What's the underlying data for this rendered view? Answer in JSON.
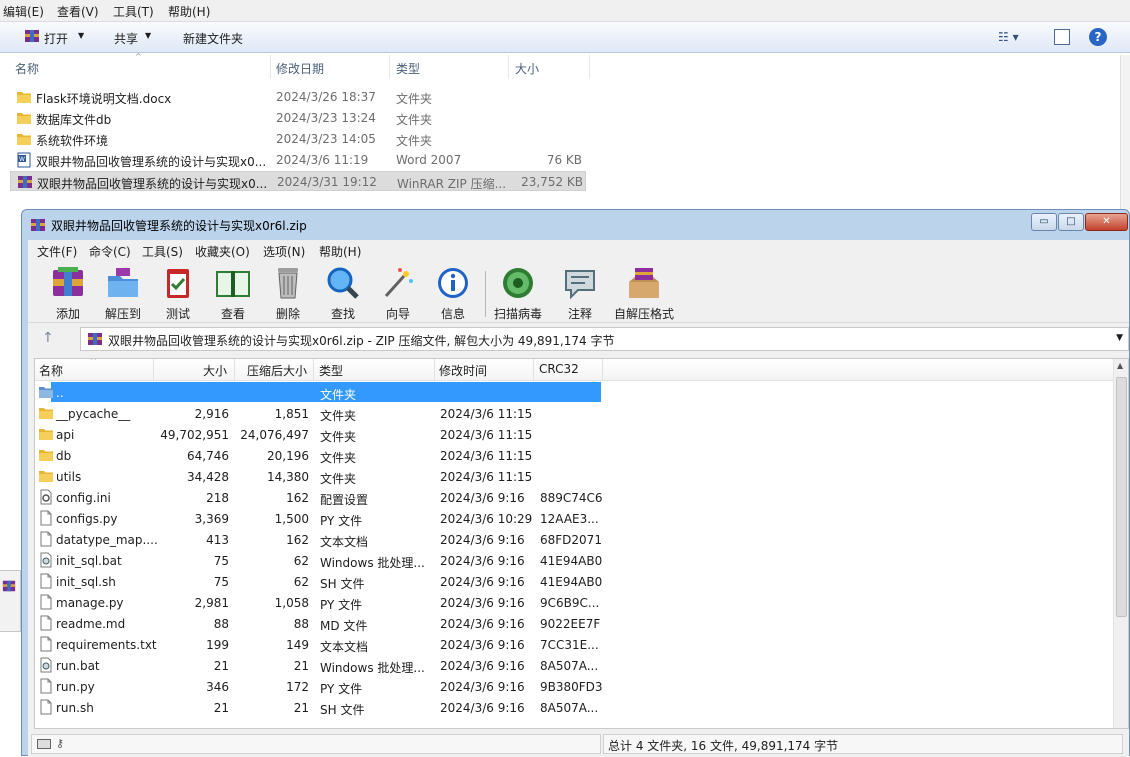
{
  "explorer": {
    "menu": [
      "编辑(E)",
      "查看(V)",
      "工具(T)",
      "帮助(H)"
    ],
    "toolbar": {
      "open": "打开",
      "share": "共享",
      "new_folder": "新建文件夹"
    },
    "columns": {
      "name": "名称",
      "date": "修改日期",
      "type": "类型",
      "size": "大小"
    },
    "files": [
      {
        "icon": "folder-icon",
        "name": "Flask环境说明文档.docx",
        "date": "2024/3/26 18:37",
        "type": "文件夹",
        "size": ""
      },
      {
        "icon": "folder-icon",
        "name": "数据库文件db",
        "date": "2024/3/23 13:24",
        "type": "文件夹",
        "size": ""
      },
      {
        "icon": "folder-icon",
        "name": "系统软件环境",
        "date": "2024/3/23 14:05",
        "type": "文件夹",
        "size": ""
      },
      {
        "icon": "word-doc-icon",
        "name": "双眼井物品回收管理系统的设计与实现x0...",
        "date": "2024/3/6 11:19",
        "type": "Word 2007",
        "size": "76 KB"
      },
      {
        "icon": "winrar-archive-icon",
        "name": "双眼井物品回收管理系统的设计与实现x0...",
        "date": "2024/3/31 19:12",
        "type": "WinRAR ZIP 压缩...",
        "size": "23,752 KB",
        "selected": true
      }
    ]
  },
  "rar": {
    "title": "双眼井物品回收管理系统的设计与实现x0r6l.zip",
    "window_buttons": {
      "minimize": "▭",
      "maximize": "□",
      "close": "✕"
    },
    "menu": [
      "文件(F)",
      "命令(C)",
      "工具(S)",
      "收藏夹(O)",
      "选项(N)",
      "帮助(H)"
    ],
    "tools": [
      {
        "icon": "add-archive-icon",
        "label": "添加"
      },
      {
        "icon": "extract-to-icon",
        "label": "解压到"
      },
      {
        "icon": "test-icon",
        "label": "测试"
      },
      {
        "icon": "view-icon",
        "label": "查看"
      },
      {
        "icon": "delete-icon",
        "label": "删除"
      },
      {
        "icon": "find-icon",
        "label": "查找"
      },
      {
        "icon": "wizard-icon",
        "label": "向导"
      },
      {
        "icon": "info-icon",
        "label": "信息"
      },
      {
        "icon": "virus-scan-icon",
        "label": "扫描病毒"
      },
      {
        "icon": "comment-icon",
        "label": "注释"
      },
      {
        "icon": "sfx-icon",
        "label": "自解压格式"
      }
    ],
    "address": "双眼井物品回收管理系统的设计与实现x0r6l.zip - ZIP 压缩文件, 解包大小为 49,891,174 字节",
    "columns": {
      "name": "名称",
      "size": "大小",
      "packed": "压缩后大小",
      "type": "类型",
      "modified": "修改时间",
      "crc": "CRC32"
    },
    "rows": [
      {
        "icon": "parent-folder-icon",
        "name": "..",
        "size": "",
        "packed": "",
        "type": "文件夹",
        "modified": "",
        "crc": "",
        "selected": true
      },
      {
        "icon": "folder-icon",
        "name": "__pycache__",
        "size": "2,916",
        "packed": "1,851",
        "type": "文件夹",
        "modified": "2024/3/6 11:15",
        "crc": ""
      },
      {
        "icon": "folder-icon",
        "name": "api",
        "size": "49,702,951",
        "packed": "24,076,497",
        "type": "文件夹",
        "modified": "2024/3/6 11:15",
        "crc": ""
      },
      {
        "icon": "folder-icon",
        "name": "db",
        "size": "64,746",
        "packed": "20,196",
        "type": "文件夹",
        "modified": "2024/3/6 11:15",
        "crc": ""
      },
      {
        "icon": "folder-icon",
        "name": "utils",
        "size": "34,428",
        "packed": "14,380",
        "type": "文件夹",
        "modified": "2024/3/6 11:15",
        "crc": ""
      },
      {
        "icon": "settings-file-icon",
        "name": "config.ini",
        "size": "218",
        "packed": "162",
        "type": "配置设置",
        "modified": "2024/3/6 9:16",
        "crc": "889C74C6"
      },
      {
        "icon": "file-icon",
        "name": "configs.py",
        "size": "3,369",
        "packed": "1,500",
        "type": "PY 文件",
        "modified": "2024/3/6 10:29",
        "crc": "12AAE3..."
      },
      {
        "icon": "file-icon",
        "name": "datatype_map....",
        "size": "413",
        "packed": "162",
        "type": "文本文档",
        "modified": "2024/3/6 9:16",
        "crc": "68FD2071"
      },
      {
        "icon": "batch-file-icon",
        "name": "init_sql.bat",
        "size": "75",
        "packed": "62",
        "type": "Windows 批处理...",
        "modified": "2024/3/6 9:16",
        "crc": "41E94AB0"
      },
      {
        "icon": "file-icon",
        "name": "init_sql.sh",
        "size": "75",
        "packed": "62",
        "type": "SH 文件",
        "modified": "2024/3/6 9:16",
        "crc": "41E94AB0"
      },
      {
        "icon": "file-icon",
        "name": "manage.py",
        "size": "2,981",
        "packed": "1,058",
        "type": "PY 文件",
        "modified": "2024/3/6 9:16",
        "crc": "9C6B9C..."
      },
      {
        "icon": "file-icon",
        "name": "readme.md",
        "size": "88",
        "packed": "88",
        "type": "MD 文件",
        "modified": "2024/3/6 9:16",
        "crc": "9022EE7F"
      },
      {
        "icon": "file-icon",
        "name": "requirements.txt",
        "size": "199",
        "packed": "149",
        "type": "文本文档",
        "modified": "2024/3/6 9:16",
        "crc": "7CC31E..."
      },
      {
        "icon": "batch-file-icon",
        "name": "run.bat",
        "size": "21",
        "packed": "21",
        "type": "Windows 批处理...",
        "modified": "2024/3/6 9:16",
        "crc": "8A507A..."
      },
      {
        "icon": "file-icon",
        "name": "run.py",
        "size": "346",
        "packed": "172",
        "type": "PY 文件",
        "modified": "2024/3/6 9:16",
        "crc": "9B380FD3"
      },
      {
        "icon": "file-icon",
        "name": "run.sh",
        "size": "21",
        "packed": "21",
        "type": "SH 文件",
        "modified": "2024/3/6 9:16",
        "crc": "8A507A..."
      }
    ],
    "status": "总计 4 文件夹, 16 文件, 49,891,174 字节"
  }
}
